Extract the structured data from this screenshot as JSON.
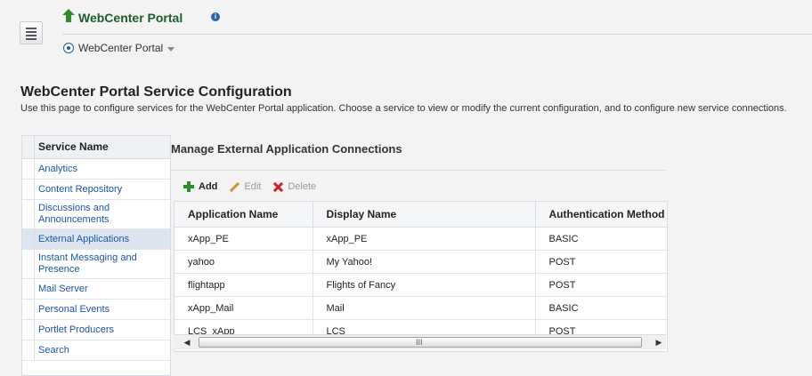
{
  "header": {
    "portal_title": "WebCenter Portal",
    "breadcrumb": "WebCenter Portal"
  },
  "page": {
    "title": "WebCenter Portal Service Configuration",
    "description": "Use this page to configure services for the WebCenter Portal application. Choose a service to view or modify the current configuration, and to configure new service connections."
  },
  "sidebar": {
    "header": "Service Name",
    "items": [
      {
        "label": "Analytics",
        "selected": false
      },
      {
        "label": "Content Repository",
        "selected": false
      },
      {
        "label": "Discussions and Announcements",
        "selected": false
      },
      {
        "label": "External Applications",
        "selected": true
      },
      {
        "label": "Instant Messaging and Presence",
        "selected": false
      },
      {
        "label": "Mail Server",
        "selected": false
      },
      {
        "label": "Personal Events",
        "selected": false
      },
      {
        "label": "Portlet Producers",
        "selected": false
      },
      {
        "label": "Search",
        "selected": false
      }
    ]
  },
  "main": {
    "title": "Manage External Application Connections",
    "toolbar": {
      "add_label": "Add",
      "edit_label": "Edit",
      "delete_label": "Delete"
    },
    "table": {
      "columns": [
        "Application Name",
        "Display Name",
        "Authentication Method"
      ],
      "rows": [
        [
          "xApp_PE",
          "xApp_PE",
          "BASIC"
        ],
        [
          "yahoo",
          "My Yahoo!",
          "POST"
        ],
        [
          "flightapp",
          "Flights of Fancy",
          "POST"
        ],
        [
          "xApp_Mail",
          "Mail",
          "BASIC"
        ],
        [
          "LCS_xApp",
          "LCS",
          "POST"
        ]
      ]
    },
    "scrollbar_grip": "III"
  },
  "colors": {
    "link": "#1b57a6",
    "portal_title": "#1f5c2b",
    "selected_row": "#dde6f0"
  },
  "icons": {
    "nav": "menu-icon",
    "up": "up-arrow-icon",
    "info": "info-icon",
    "add": "plus-icon",
    "edit": "pencil-icon",
    "delete": "x-icon"
  }
}
